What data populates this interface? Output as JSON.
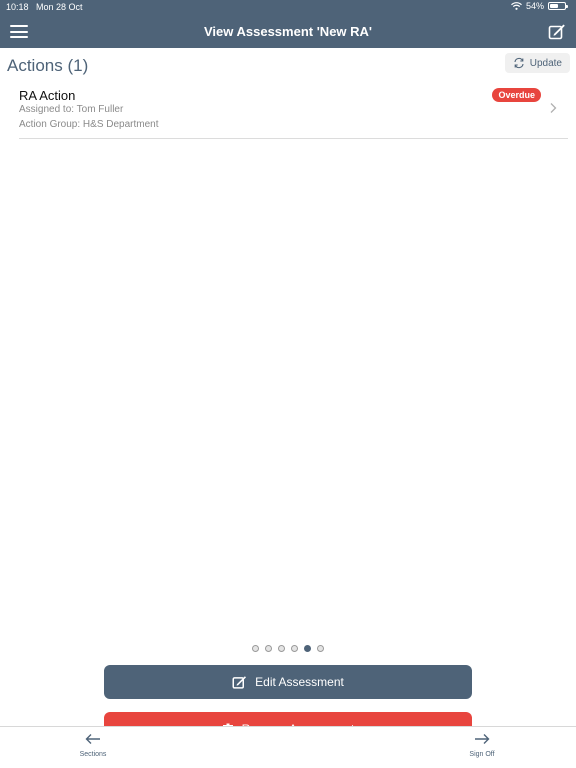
{
  "status_bar": {
    "time": "10:18",
    "date": "Mon 28 Oct",
    "battery": "54%",
    "battery_level": 0.54
  },
  "nav": {
    "title": "View Assessment 'New RA'"
  },
  "actions": {
    "title": "Actions (1)",
    "update_label": "Update",
    "items": [
      {
        "title": "RA Action",
        "assigned_to": "Assigned to: Tom Fuller",
        "action_group": "Action Group: H&S Department",
        "badge": "Overdue",
        "badge_color": "#e8453e"
      }
    ]
  },
  "pager": {
    "count": 6,
    "active_index": 4
  },
  "buttons": {
    "edit_label": "Edit Assessment",
    "remove_label": "Remove Assessment"
  },
  "toolbar": {
    "left_label": "Sections",
    "right_label": "Sign Off"
  },
  "colors": {
    "primary": "#4e6378",
    "danger": "#e8453e"
  },
  "icons": [
    "menu-icon",
    "edit-icon",
    "refresh-icon",
    "chevron-right-icon",
    "trash-icon",
    "arrow-left-icon",
    "arrow-right-icon",
    "wifi-icon",
    "battery-icon"
  ]
}
